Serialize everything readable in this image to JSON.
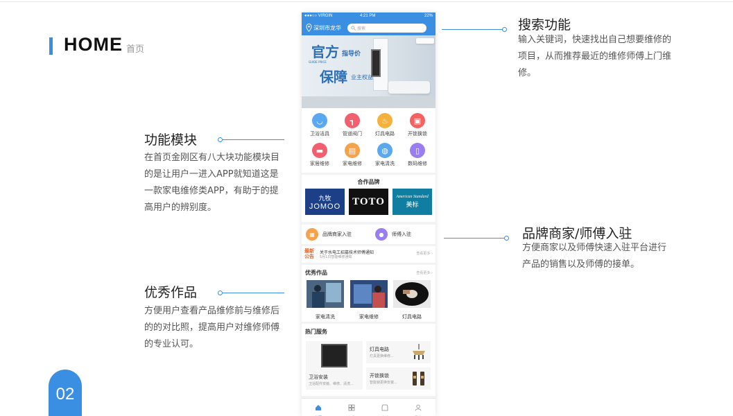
{
  "page": {
    "title": "HOME",
    "subtitle": "首页",
    "page_number": "02"
  },
  "annotations": {
    "search": {
      "title": "搜索功能",
      "text": "输入关键词，快速找出自己想要维修的项目，从而推荐最近的维修师傅上门维修。"
    },
    "modules": {
      "title": "功能模块",
      "text": "在首页金刚区有八大块功能模块目的是让用户一进入APP就知道这是一款家电维修类APP，有助于的提高用户的辨别度。"
    },
    "brand_entry": {
      "title": "品牌商家/师傅入驻",
      "text": "方便商家以及师傅快速入驻平台进行产品的销售以及师傅的接单。"
    },
    "works": {
      "title": "优秀作品",
      "text": "方便用户查看产品维修前与维修后的的对比照，提高用户对维修师傅的专业认可。"
    }
  },
  "phone": {
    "status": {
      "carrier": "●●●○○ VIRGIN",
      "time": "4:21 PM",
      "battery": "22%"
    },
    "location": "深圳市龙华",
    "search_placeholder": "搜索",
    "banner": {
      "line1": "官方",
      "line1_suffix": "指导价",
      "line1_small": "GUIDE PRICE",
      "line2": "保障",
      "line2_suffix": "业主权益"
    },
    "modules": [
      {
        "label": "卫浴洁具",
        "icon": "bathtub-icon",
        "color": "#5aa9f0"
      },
      {
        "label": "管道阀门",
        "icon": "pipe-icon",
        "color": "#f2606f"
      },
      {
        "label": "灯具电路",
        "icon": "lamp-icon",
        "color": "#f5b13c"
      },
      {
        "label": "开锁换锁",
        "icon": "lock-icon",
        "color": "#f3625e"
      },
      {
        "label": "家居维修",
        "icon": "sofa-icon",
        "color": "#f2606f"
      },
      {
        "label": "家电维修",
        "icon": "appliance-icon",
        "color": "#f5a24a"
      },
      {
        "label": "家电清洗",
        "icon": "washer-icon",
        "color": "#5aa9f0"
      },
      {
        "label": "数码维修",
        "icon": "tablet-icon",
        "color": "#9a7ef0"
      }
    ],
    "brands_title": "合作品牌",
    "brands": [
      {
        "cn": "九牧",
        "en": "JOMOO",
        "color": "#1c3f88"
      },
      {
        "cn": "",
        "en": "TOTO",
        "color": "#111111"
      },
      {
        "cn": "美标",
        "en": "American Standard",
        "color": "#0f7ea0"
      }
    ],
    "entries": [
      {
        "label": "品牌商家入驻",
        "icon": "shop-icon",
        "color": "#f5a24a"
      },
      {
        "label": "师傅入驻",
        "icon": "worker-icon",
        "color": "#9a7ef0"
      }
    ],
    "notice": {
      "tag": "最新公告",
      "line1": "关于水电工招募技术师傅通知",
      "line2": "5月1日智能维修通知",
      "more": "查看更多"
    },
    "works_title": "优秀作品",
    "works_more": "查看更多",
    "works": [
      {
        "label": "家电清洗"
      },
      {
        "label": "家电维修"
      },
      {
        "label": "灯具电路"
      }
    ],
    "hot_title": "热门服务",
    "hot": {
      "big": {
        "title": "卫浴安装",
        "desc": "卫浴配件安装、维修、清洗..."
      },
      "small": [
        {
          "title": "灯具电路",
          "desc": "灯具更换维修..."
        },
        {
          "title": "开锁换锁",
          "desc": "智能锁更换安装..."
        }
      ]
    },
    "tabs": [
      {
        "label": "首页",
        "icon": "home-icon",
        "active": true
      },
      {
        "label": "分类",
        "icon": "grid-icon",
        "active": false
      },
      {
        "label": "商城",
        "icon": "store-icon",
        "active": false
      },
      {
        "label": "我的",
        "icon": "user-icon",
        "active": false
      }
    ]
  }
}
